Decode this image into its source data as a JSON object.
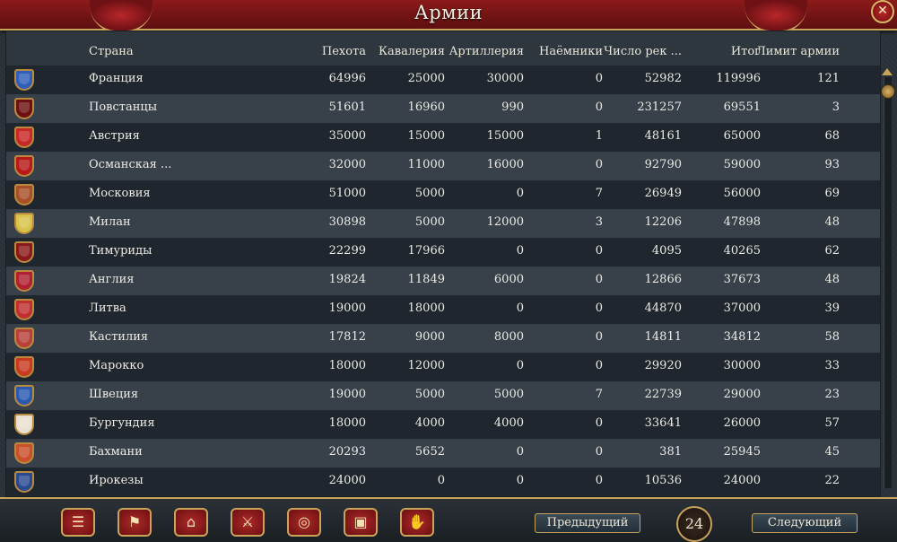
{
  "window": {
    "title": "Армии",
    "close_label": "✕"
  },
  "table": {
    "headers": {
      "country": "Страна",
      "infantry": "Пехота",
      "cavalry": "Кавалерия",
      "artillery": "Артиллерия",
      "mercenaries": "Наёмники",
      "recruits": "Число рек ...",
      "total": "Итог",
      "limit": "Лимит армии"
    },
    "rows": [
      {
        "country": "Франция",
        "infantry": "64996",
        "cavalry": "25000",
        "artillery": "30000",
        "mercenaries": "0",
        "recruits": "52982",
        "total": "119996",
        "limit": "121",
        "color": "#2f5fb8"
      },
      {
        "country": "Повстанцы",
        "infantry": "51601",
        "cavalry": "16960",
        "artillery": "990",
        "mercenaries": "0",
        "recruits": "231257",
        "total": "69551",
        "limit": "3",
        "color": "#6e1010"
      },
      {
        "country": "Австрия",
        "infantry": "35000",
        "cavalry": "15000",
        "artillery": "15000",
        "mercenaries": "1",
        "recruits": "48161",
        "total": "65000",
        "limit": "68",
        "color": "#c82828"
      },
      {
        "country": "Османская ...",
        "infantry": "32000",
        "cavalry": "11000",
        "artillery": "16000",
        "mercenaries": "0",
        "recruits": "92790",
        "total": "59000",
        "limit": "93",
        "color": "#b81818"
      },
      {
        "country": "Московия",
        "infantry": "51000",
        "cavalry": "5000",
        "artillery": "0",
        "mercenaries": "7",
        "recruits": "26949",
        "total": "56000",
        "limit": "69",
        "color": "#a8502a"
      },
      {
        "country": "Милан",
        "infantry": "30898",
        "cavalry": "5000",
        "artillery": "12000",
        "mercenaries": "3",
        "recruits": "12206",
        "total": "47898",
        "limit": "48",
        "color": "#d8c24a"
      },
      {
        "country": "Тимуриды",
        "infantry": "22299",
        "cavalry": "17966",
        "artillery": "0",
        "mercenaries": "0",
        "recruits": "4095",
        "total": "40265",
        "limit": "62",
        "color": "#8a1a1a"
      },
      {
        "country": "Англия",
        "infantry": "19824",
        "cavalry": "11849",
        "artillery": "6000",
        "mercenaries": "0",
        "recruits": "12866",
        "total": "37673",
        "limit": "48",
        "color": "#b02030"
      },
      {
        "country": "Литва",
        "infantry": "19000",
        "cavalry": "18000",
        "artillery": "0",
        "mercenaries": "0",
        "recruits": "44870",
        "total": "37000",
        "limit": "39",
        "color": "#c03030"
      },
      {
        "country": "Кастилия",
        "infantry": "17812",
        "cavalry": "9000",
        "artillery": "8000",
        "mercenaries": "0",
        "recruits": "14811",
        "total": "34812",
        "limit": "58",
        "color": "#b8403a"
      },
      {
        "country": "Марокко",
        "infantry": "18000",
        "cavalry": "12000",
        "artillery": "0",
        "mercenaries": "0",
        "recruits": "29920",
        "total": "30000",
        "limit": "33",
        "color": "#c83a22"
      },
      {
        "country": "Швеция",
        "infantry": "19000",
        "cavalry": "5000",
        "artillery": "5000",
        "mercenaries": "7",
        "recruits": "22739",
        "total": "29000",
        "limit": "23",
        "color": "#2a5ab0"
      },
      {
        "country": "Бургундия",
        "infantry": "18000",
        "cavalry": "4000",
        "artillery": "4000",
        "mercenaries": "0",
        "recruits": "33641",
        "total": "26000",
        "limit": "57",
        "color": "#e8e0d0"
      },
      {
        "country": "Бахмани",
        "infantry": "20293",
        "cavalry": "5652",
        "artillery": "0",
        "mercenaries": "0",
        "recruits": "381",
        "total": "25945",
        "limit": "45",
        "color": "#c8502a"
      },
      {
        "country": "Ирокезы",
        "infantry": "24000",
        "cavalry": "0",
        "artillery": "0",
        "mercenaries": "0",
        "recruits": "10536",
        "total": "24000",
        "limit": "22",
        "color": "#2a4a90"
      }
    ]
  },
  "footer": {
    "buttons": [
      {
        "icon": "ledger-icon",
        "glyph": "☰"
      },
      {
        "icon": "flag-icon",
        "glyph": "⚑"
      },
      {
        "icon": "buildings-icon",
        "glyph": "⌂"
      },
      {
        "icon": "crossed-swords-icon",
        "glyph": "⚔"
      },
      {
        "icon": "coins-icon",
        "glyph": "◎"
      },
      {
        "icon": "chest-icon",
        "glyph": "▣"
      },
      {
        "icon": "handshake-icon",
        "glyph": "✋"
      }
    ],
    "prev_label": "Предыдущий",
    "next_label": "Следующий",
    "page": "24"
  },
  "colors": {
    "accent_gold": "#c8a35a",
    "title_red": "#8c1a1a"
  }
}
